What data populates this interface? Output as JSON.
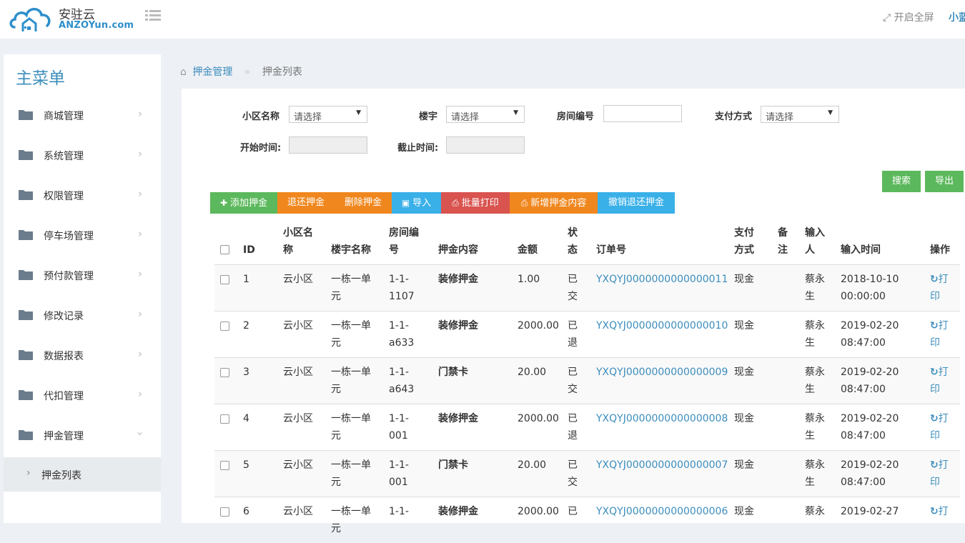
{
  "header": {
    "logo_cn": "安驻云",
    "logo_en_main": "ANZOYun",
    "logo_en_suffix": ".com",
    "fullscreen_label": "开启全屏",
    "user_name": "小蓝"
  },
  "sidebar": {
    "title": "主菜单",
    "items": [
      {
        "label": "商城管理"
      },
      {
        "label": "系统管理"
      },
      {
        "label": "权限管理"
      },
      {
        "label": "停车场管理"
      },
      {
        "label": "预付款管理"
      },
      {
        "label": "修改记录"
      },
      {
        "label": "数据报表"
      },
      {
        "label": "代扣管理"
      },
      {
        "label": "押金管理"
      }
    ],
    "sub_item": "押金列表"
  },
  "breadcrumb": {
    "parent": "押金管理",
    "current": "押金列表"
  },
  "filters": {
    "community_label": "小区名称",
    "community_value": "请选择",
    "building_label": "楼宇",
    "building_value": "请选择",
    "room_label": "房间编号",
    "room_value": "",
    "payment_label": "支付方式",
    "payment_value": "请选择",
    "start_label": "开始时间:",
    "end_label": "截止时间:"
  },
  "actions": {
    "search": "搜索",
    "export": "导出",
    "add": "添加押金",
    "refund": "退还押金",
    "delete": "删除押金",
    "import": "导入",
    "batch_print": "批量打印",
    "new_content": "新增押金内容",
    "cancel_refund": "撤销退还押金"
  },
  "colors": {
    "green": "#5cb85c",
    "orange": "#f0871e",
    "blue": "#3ab0e8",
    "red": "#d9534f",
    "link": "#3c8dbc"
  },
  "table": {
    "headers": {
      "id": "ID",
      "community_1": "小区名",
      "community_2": "称",
      "building": "楼宇名称",
      "room_1": "房间编",
      "room_2": "号",
      "content": "押金内容",
      "amount": "金额",
      "status_1": "状",
      "status_2": "态",
      "order": "订单号",
      "pay_1": "支付",
      "pay_2": "方式",
      "remark_1": "备",
      "remark_2": "注",
      "inputter_1": "输入",
      "inputter_2": "人",
      "time": "输入时间",
      "op": "操作"
    },
    "rows": [
      {
        "id": "1",
        "community": "云小区",
        "b1": "一栋一单",
        "b2": "元",
        "r1": "1-1-",
        "r2": "1107",
        "content": "装修押金",
        "amount": "1.00",
        "s1": "已",
        "s2": "交",
        "order": "YXQYJ0000000000000011",
        "pay": "现金",
        "u1": "蔡永",
        "u2": "生",
        "t1": "2018-10-10",
        "t2": "00:00:00",
        "p1": "打",
        "p2": "印"
      },
      {
        "id": "2",
        "community": "云小区",
        "b1": "一栋一单",
        "b2": "元",
        "r1": "1-1-",
        "r2": "a633",
        "content": "装修押金",
        "amount": "2000.00",
        "s1": "已",
        "s2": "退",
        "order": "YXQYJ0000000000000010",
        "pay": "现金",
        "u1": "蔡永",
        "u2": "生",
        "t1": "2019-02-20",
        "t2": "08:47:00",
        "p1": "打",
        "p2": "印"
      },
      {
        "id": "3",
        "community": "云小区",
        "b1": "一栋一单",
        "b2": "元",
        "r1": "1-1-",
        "r2": "a643",
        "content": "门禁卡",
        "amount": "20.00",
        "s1": "已",
        "s2": "交",
        "order": "YXQYJ0000000000000009",
        "pay": "现金",
        "u1": "蔡永",
        "u2": "生",
        "t1": "2019-02-20",
        "t2": "08:47:00",
        "p1": "打",
        "p2": "印"
      },
      {
        "id": "4",
        "community": "云小区",
        "b1": "一栋一单",
        "b2": "元",
        "r1": "1-1-",
        "r2": "001",
        "content": "装修押金",
        "amount": "2000.00",
        "s1": "已",
        "s2": "退",
        "order": "YXQYJ0000000000000008",
        "pay": "现金",
        "u1": "蔡永",
        "u2": "生",
        "t1": "2019-02-20",
        "t2": "08:47:00",
        "p1": "打",
        "p2": "印"
      },
      {
        "id": "5",
        "community": "云小区",
        "b1": "一栋一单",
        "b2": "元",
        "r1": "1-1-",
        "r2": "001",
        "content": "门禁卡",
        "amount": "20.00",
        "s1": "已",
        "s2": "交",
        "order": "YXQYJ0000000000000007",
        "pay": "现金",
        "u1": "蔡永",
        "u2": "生",
        "t1": "2019-02-20",
        "t2": "08:47:00",
        "p1": "打",
        "p2": "印"
      },
      {
        "id": "6",
        "community": "云小区",
        "b1": "一栋一单",
        "b2": "元",
        "r1": "1-1-",
        "r2": "",
        "content": "装修押金",
        "amount": "2000.00",
        "s1": "已",
        "s2": "",
        "order": "YXQYJ0000000000000006",
        "pay": "现金",
        "u1": "蔡永",
        "u2": "",
        "t1": "2019-02-27",
        "t2": "",
        "p1": "打",
        "p2": ""
      }
    ]
  }
}
